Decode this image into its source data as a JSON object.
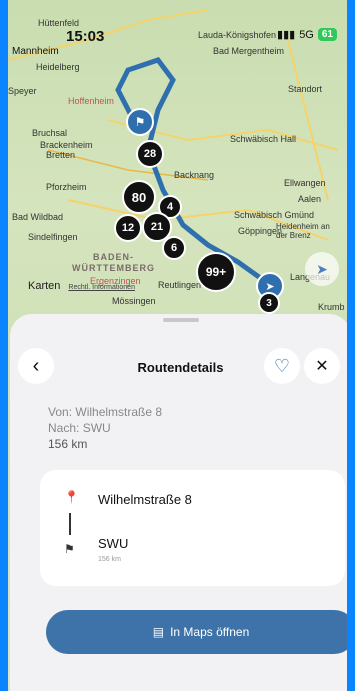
{
  "status_bar": {
    "time": "15:03",
    "network": "5G",
    "battery": "61"
  },
  "map": {
    "places": [
      "Hüttenfeld",
      "Lauda-Königshofen",
      "Mannheim",
      "Bad Mergentheim",
      "Heidelberg",
      "Speyer",
      "Hoffenheim",
      "Standort",
      "Bruchsal",
      "Brackenheim",
      "Bretten",
      "Schwäbisch Hall",
      "Backnang",
      "Pforzheim",
      "Ellwangen",
      "Aalen",
      "Bad Wildbad",
      "Schwäbisch Gmünd",
      "Heidenheim an der Brenz",
      "Sindelfingen",
      "Göppingen",
      "Reutlingen",
      "Ergenzingen",
      "Mössingen",
      "Langenau",
      "Krumb"
    ],
    "region_label": "BADEN-\nWÜRTTEMBERG",
    "clusters": [
      "28",
      "80",
      "4",
      "12",
      "21",
      "6",
      "99+",
      "3"
    ],
    "attribution": "Karten",
    "legal_link": "Rechtl. Informationen",
    "icons": [
      "flag-icon",
      "location-arrow-icon"
    ]
  },
  "sheet": {
    "title": "Routendetails",
    "back_icon": "chevron-left-icon",
    "favorite_icon": "heart-icon",
    "close_icon": "close-icon",
    "from_label": "Von:",
    "from_value": "Wilhelmstraße 8",
    "to_label": "Nach:",
    "to_value": "SWU",
    "distance": "156 km",
    "stops": [
      {
        "name": "Wilhelmstraße 8",
        "icon": "pin-icon"
      },
      {
        "name": "SWU",
        "sub": "156 km",
        "icon": "flag-icon"
      }
    ],
    "maps_button": "In Maps öffnen"
  }
}
